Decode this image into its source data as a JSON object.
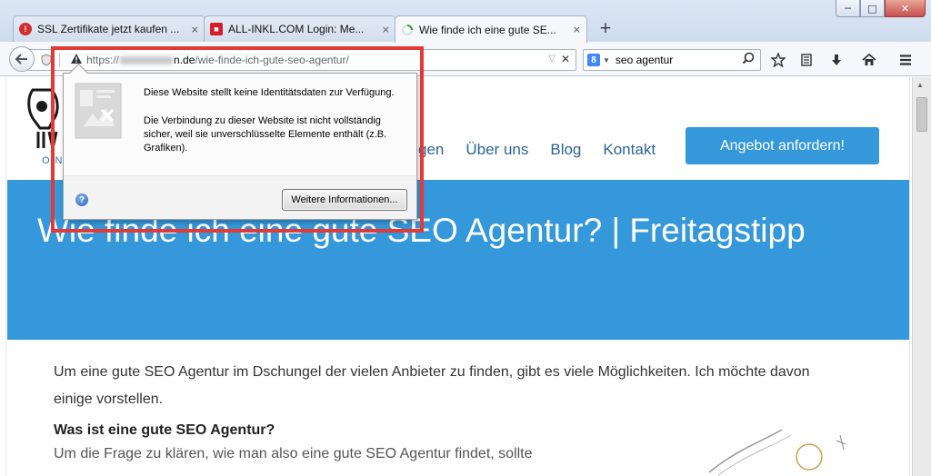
{
  "window": {
    "minimize_glyph": "─",
    "maximize_glyph": "□",
    "close_glyph": "✕"
  },
  "tabs": [
    {
      "title": "SSL Zertifikate jetzt kaufen ...",
      "icon": "ssl-favicon",
      "icon_color": "#d32f2f",
      "active": false
    },
    {
      "title": "ALL-INKL.COM Login: Me...",
      "icon": "allinkl-favicon",
      "icon_color": "#d81b2a",
      "active": false
    },
    {
      "title": "Wie finde ich eine gute SE...",
      "icon": "loading-spinner-icon",
      "icon_color": "#2e9e3f",
      "active": true
    }
  ],
  "tab_close_glyph": "×",
  "new_tab_glyph": "+",
  "urlbar": {
    "scheme": "https://",
    "host_suffix": "n.de",
    "path": "/wie-finde-ich-gute-seo-agentur/"
  },
  "search": {
    "engine": "g-logo-icon",
    "value": "seo agentur"
  },
  "toolbar_icons": [
    "star-icon",
    "reader-list-icon",
    "download-icon",
    "home-icon",
    "menu-icon"
  ],
  "popup": {
    "line1": "Diese Website stellt keine Identitätsdaten zur Verfügung.",
    "line2": "Die Verbindung zu dieser Website ist nicht vollständig sicher, weil sie unverschlüsselte Elemente enthält (z.B. Grafiken).",
    "button": "Weitere Informationen..."
  },
  "site": {
    "nav": [
      "gen",
      "Über uns",
      "Blog",
      "Kontakt"
    ],
    "cta": "Angebot anfordern!",
    "logo_text": "ON",
    "hero_title": "Wie finde ich eine gute SEO Agentur? | Freitagstipp",
    "intro": "Um eine gute SEO Agentur im Dschungel der vielen Anbieter zu finden, gibt es viele Möglichkeiten. Ich möchte davon einige vorstellen.",
    "subheading": "Was ist eine gute SEO Agentur?",
    "cut_text": "Um die Frage zu klären, wie man also eine gute SEO Agentur findet, sollte"
  },
  "colors": {
    "accent": "#3498db",
    "highlight": "#e53935",
    "link": "#2a6496"
  }
}
